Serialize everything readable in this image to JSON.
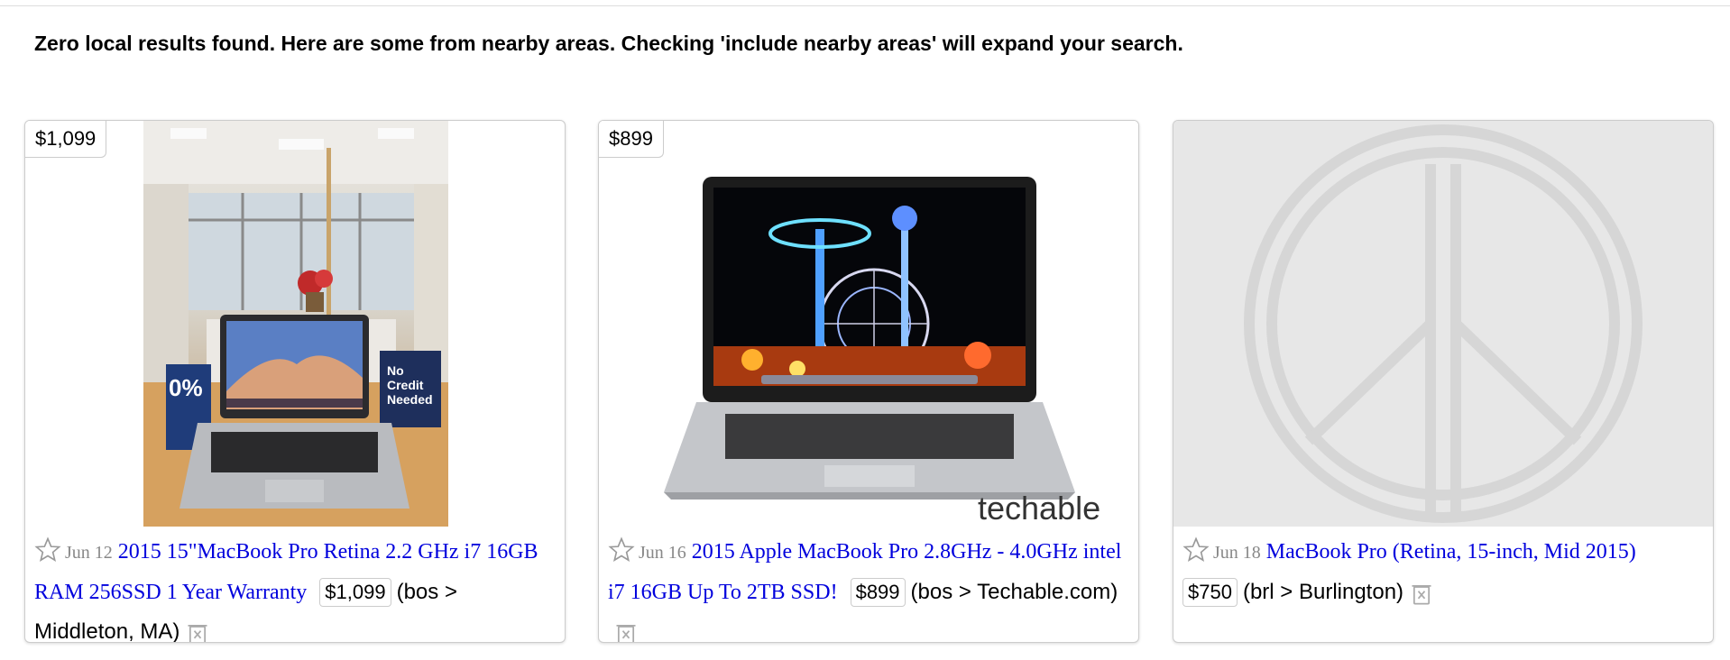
{
  "notice": "Zero local results found. Here are some from nearby areas. Checking 'include nearby areas' will expand your search.",
  "colors": {
    "link": "#0000dd",
    "date": "#888888",
    "border": "#cccccc",
    "placeholder": "#e7e7e7"
  },
  "results": [
    {
      "price_tag": "$1,099",
      "date": "Jun 12",
      "title": "2015 15\"MacBook Pro Retina 2.2 GHz i7 16GB RAM 256SSD 1 Year Warranty",
      "price": "$1,099",
      "hood": "(bos > Middleton, MA)",
      "image": "store-laptop-photo",
      "photo_text": {
        "sign": "No Credit Needed",
        "promo": "0%"
      }
    },
    {
      "price_tag": "$899",
      "date": "Jun 16",
      "title": "2015 Apple MacBook Pro 2.8GHz - 4.0GHz intel i7 16GB Up To 2TB SSD!",
      "price": "$899",
      "hood": "(bos > Techable.com)",
      "image": "macbook-fairground-photo",
      "photo_text": {
        "watermark": "techable"
      }
    },
    {
      "date": "Jun 18",
      "title": "MacBook Pro (Retina, 15-inch, Mid 2015)",
      "price": "$750",
      "hood": "(brl > Burlington)",
      "image": "peace-sign-placeholder"
    }
  ],
  "icons": {
    "favorite": "star-icon",
    "hide": "trash-icon"
  }
}
